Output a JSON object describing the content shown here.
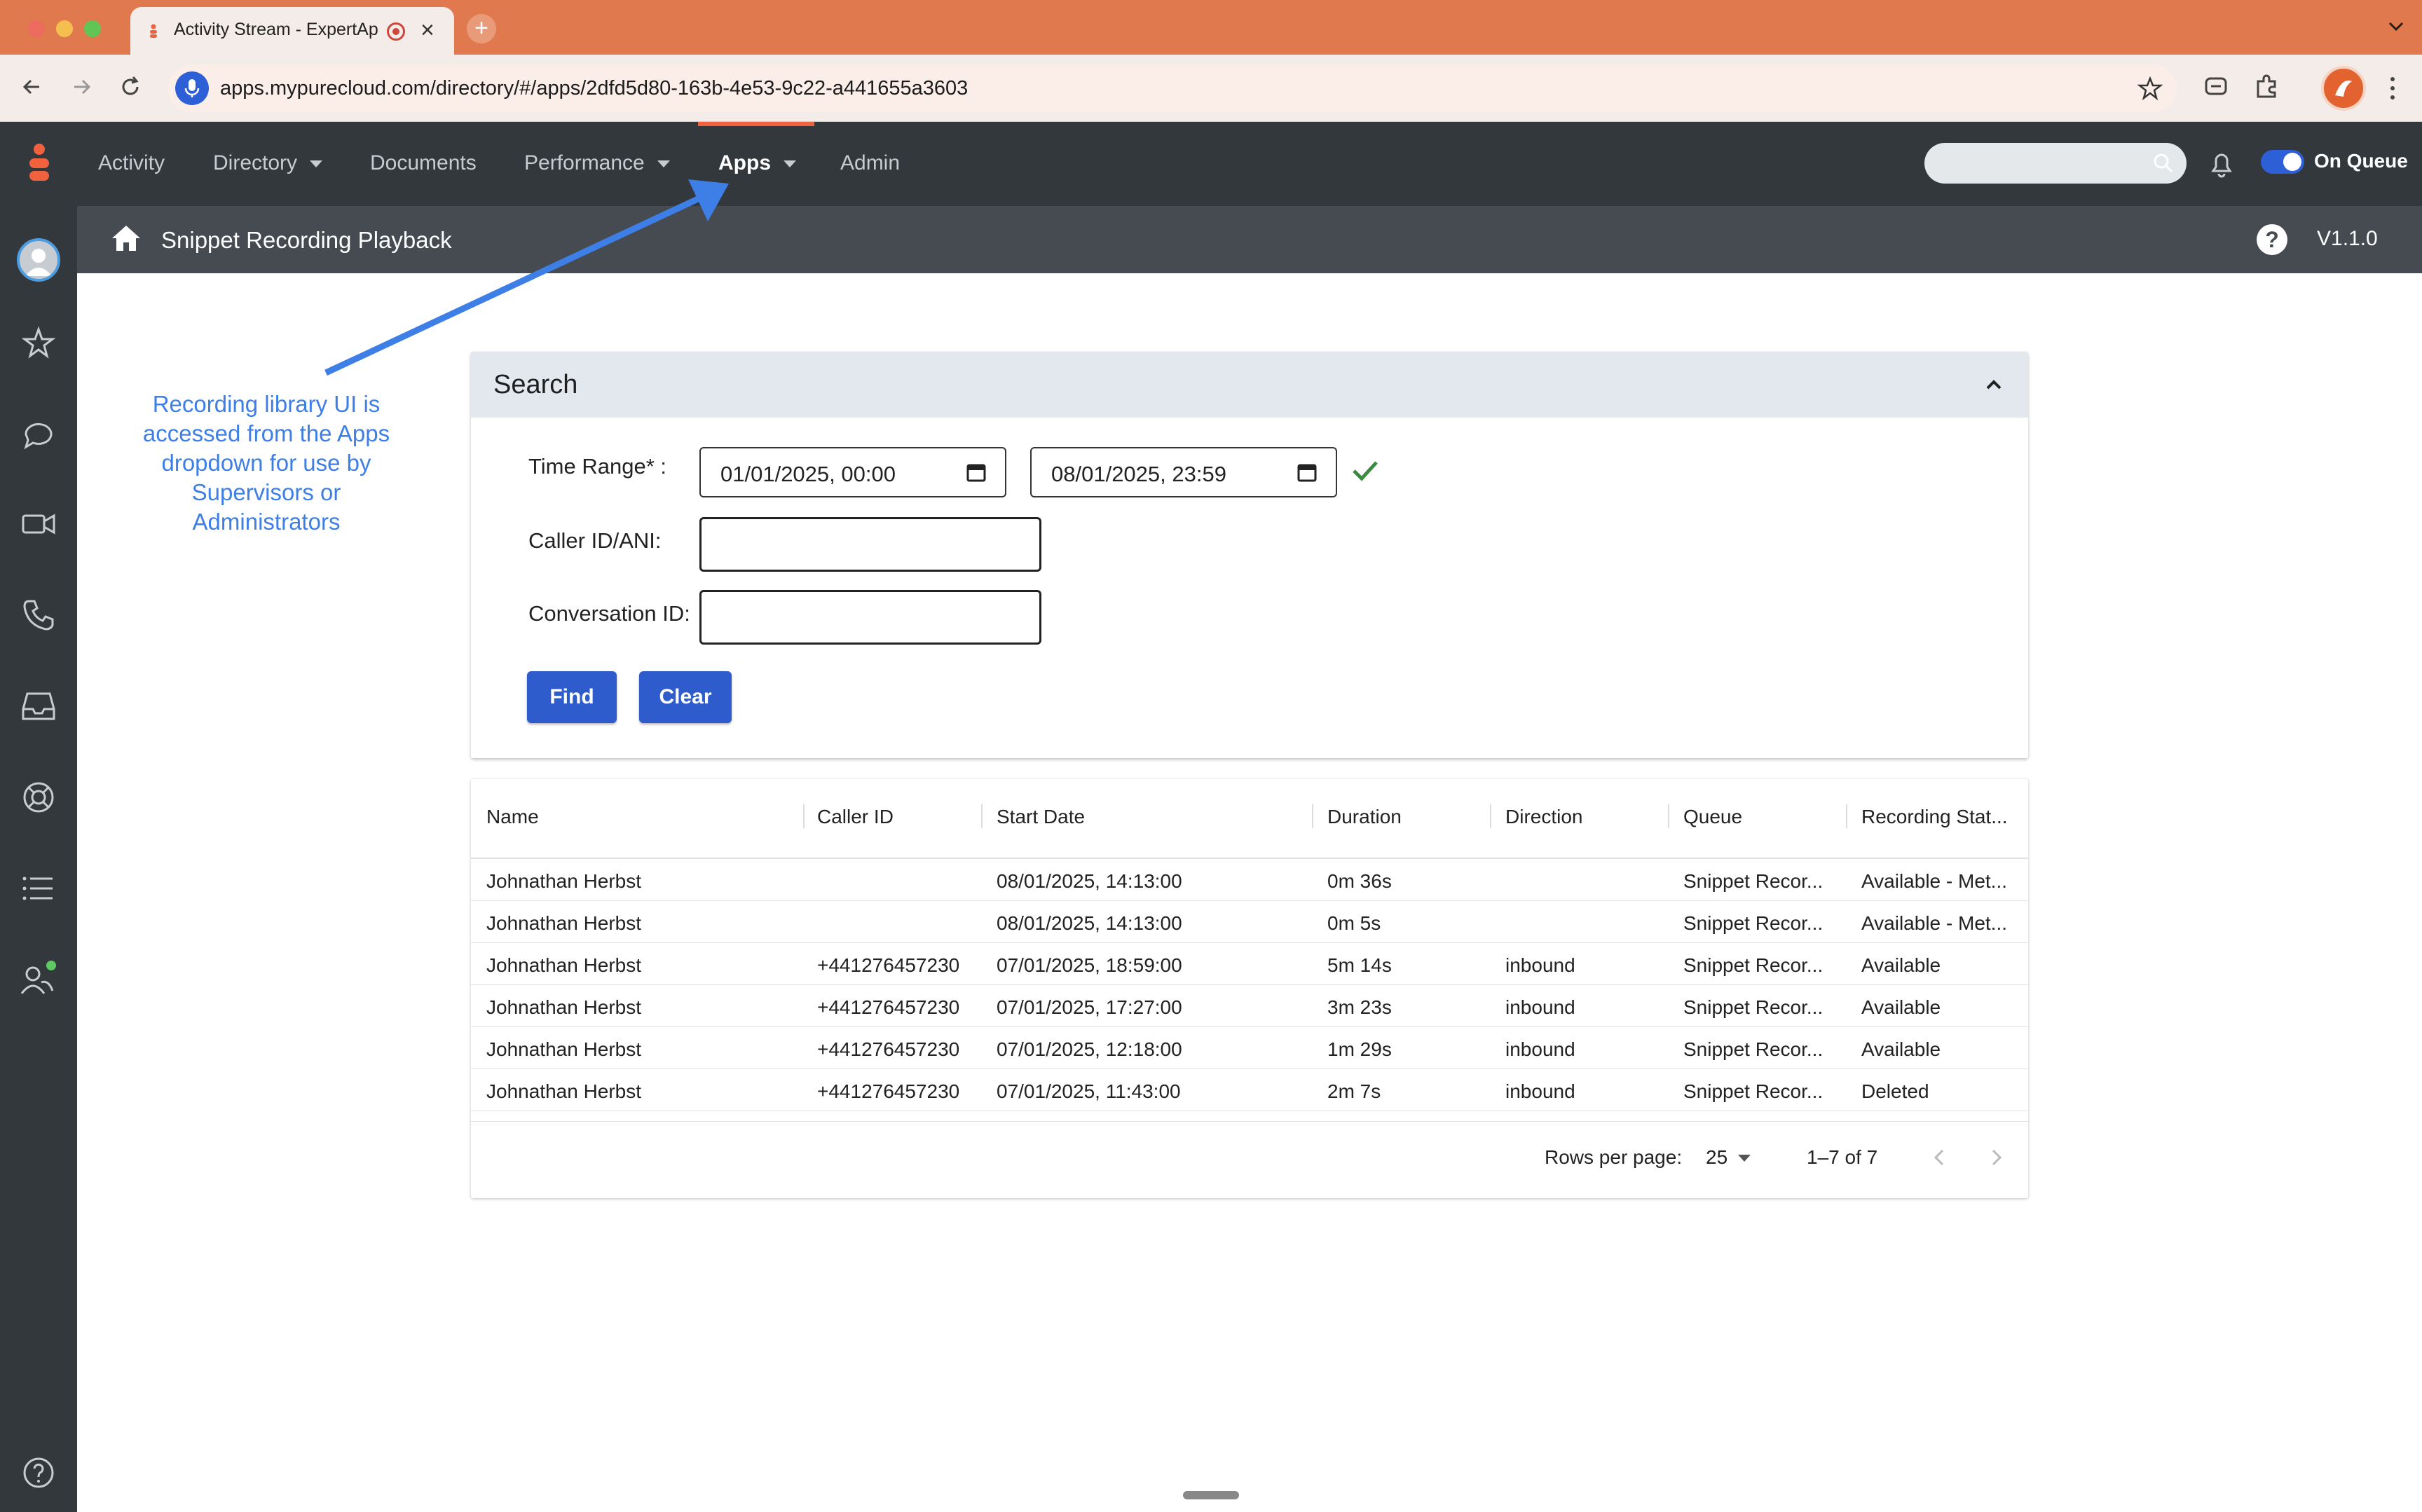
{
  "browser": {
    "tab_title": "Activity Stream - ExpertAp",
    "new_tab": "+",
    "close": "×",
    "url": "apps.mypurecloud.com/directory/#/apps/2dfd5d80-163b-4e53-9c22-a441655a3603"
  },
  "appnav": {
    "items": [
      {
        "label": "Activity"
      },
      {
        "label": "Directory"
      },
      {
        "label": "Documents"
      },
      {
        "label": "Performance"
      },
      {
        "label": "Apps"
      },
      {
        "label": "Admin"
      }
    ],
    "active": "Apps",
    "on_queue_label": "On Queue",
    "accent_color": "#f0613e"
  },
  "subheader": {
    "title": "Snippet Recording Playback",
    "help": "?",
    "version": "V1.1.0"
  },
  "annotation": {
    "text": "Recording library UI is accessed from the Apps dropdown for use by Supervisors or Administrators",
    "color": "#3d7fe6"
  },
  "search": {
    "title": "Search",
    "time_range_label": "Time Range* :",
    "start": "01/01/2025, 00:00",
    "end": "08/01/2025, 23:59",
    "caller_label": "Caller ID/ANI:",
    "caller_value": "",
    "conversation_label": "Conversation ID:",
    "conversation_value": "",
    "find_label": "Find",
    "clear_label": "Clear",
    "button_color": "#2e5ccd"
  },
  "table": {
    "columns": [
      "Name",
      "Caller ID",
      "Start Date",
      "Duration",
      "Direction",
      "Queue",
      "Recording Stat..."
    ],
    "rows": [
      [
        "Johnathan Herbst",
        "",
        "08/01/2025, 14:13:00",
        "0m 36s",
        "",
        "Snippet Recor...",
        "Available - Met..."
      ],
      [
        "Johnathan Herbst",
        "",
        "08/01/2025, 14:13:00",
        "0m 5s",
        "",
        "Snippet Recor...",
        "Available - Met..."
      ],
      [
        "Johnathan Herbst",
        "+441276457230",
        "07/01/2025, 18:59:00",
        "5m 14s",
        "inbound",
        "Snippet Recor...",
        "Available"
      ],
      [
        "Johnathan Herbst",
        "+441276457230",
        "07/01/2025, 17:27:00",
        "3m 23s",
        "inbound",
        "Snippet Recor...",
        "Available"
      ],
      [
        "Johnathan Herbst",
        "+441276457230",
        "07/01/2025, 12:18:00",
        "1m 29s",
        "inbound",
        "Snippet Recor...",
        "Available"
      ],
      [
        "Johnathan Herbst",
        "+441276457230",
        "07/01/2025, 11:43:00",
        "2m 7s",
        "inbound",
        "Snippet Recor...",
        "Deleted"
      ]
    ],
    "rows_per_page_label": "Rows per page:",
    "rows_per_page": "25",
    "range": "1–7 of 7"
  }
}
